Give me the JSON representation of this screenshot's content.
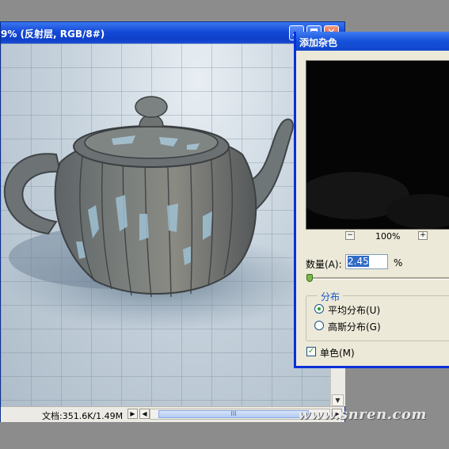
{
  "document_window": {
    "title": "9% (反射层, RGB/8#)",
    "status_text": "文档:351.6K/1.49M",
    "scroll_thumb_grip": "III"
  },
  "dialog": {
    "title": "添加杂色",
    "zoom": {
      "minus": "−",
      "plus": "+",
      "level": "100%"
    },
    "amount": {
      "label": "数量(A):",
      "value": "2.45",
      "unit": "%"
    },
    "distribution": {
      "title": "分布",
      "options": [
        {
          "label": "平均分布(U)",
          "selected": true
        },
        {
          "label": "高斯分布(G)",
          "selected": false
        }
      ]
    },
    "monochromatic": {
      "label": "单色(M)",
      "checked": true
    }
  },
  "watermark": "www.snren.com",
  "colors": {
    "titlebar": "#1449d6",
    "dialog_face": "#ece9d8",
    "preview_bg": "#050505",
    "accent_label": "#1554c8"
  },
  "icons": [
    "minimize-icon",
    "maximize-icon",
    "close-icon",
    "scroll-up-icon",
    "scroll-down-icon",
    "scroll-left-icon",
    "scroll-right-icon",
    "radio-icon",
    "checkbox-icon"
  ]
}
